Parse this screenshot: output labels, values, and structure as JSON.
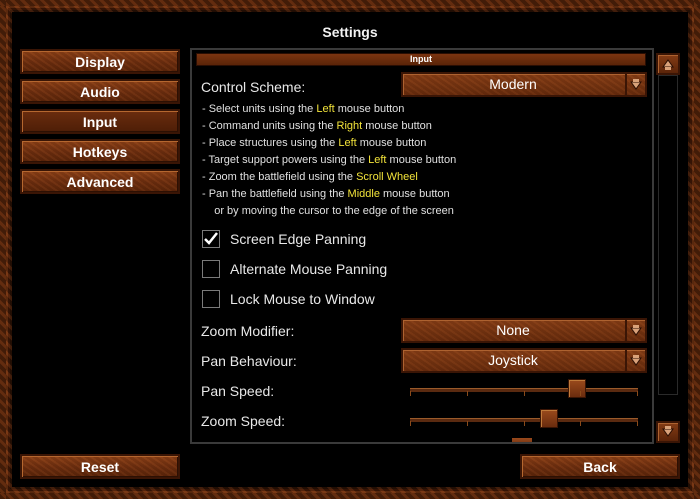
{
  "window": {
    "title": "Settings"
  },
  "nav": {
    "items": [
      {
        "label": "Display"
      },
      {
        "label": "Audio"
      },
      {
        "label": "Input",
        "active": true
      },
      {
        "label": "Hotkeys"
      },
      {
        "label": "Advanced"
      }
    ]
  },
  "panel": {
    "section_title": "Input",
    "control_scheme": {
      "label": "Control Scheme:",
      "value": "Modern"
    },
    "info_lines": [
      [
        "- Select units using the ",
        "Left",
        " mouse button"
      ],
      [
        "- Command units using the ",
        "Right",
        " mouse button"
      ],
      [
        "- Place structures using the ",
        "Left",
        " mouse button"
      ],
      [
        "- Target support powers using the ",
        "Left",
        " mouse button"
      ],
      [
        "- Zoom the battlefield using the ",
        "Scroll Wheel",
        ""
      ],
      [
        "- Pan the battlefield using the ",
        "Middle",
        " mouse button"
      ],
      [
        "  or by moving the cursor to the edge of the screen",
        "",
        ""
      ]
    ],
    "checkboxes": [
      {
        "label": "Screen Edge Panning",
        "checked": true
      },
      {
        "label": "Alternate Mouse Panning",
        "checked": false
      },
      {
        "label": "Lock Mouse to Window",
        "checked": false
      }
    ],
    "zoom_modifier": {
      "label": "Zoom Modifier:",
      "value": "None"
    },
    "pan_behaviour": {
      "label": "Pan Behaviour:",
      "value": "Joystick"
    },
    "pan_speed": {
      "label": "Pan Speed:",
      "level": 0.75
    },
    "zoom_speed": {
      "label": "Zoom Speed:",
      "level": 0.62
    }
  },
  "footer": {
    "reset_label": "Reset",
    "back_label": "Back"
  },
  "colors": {
    "highlight": "#f2e33a",
    "button": "#6a2c0e",
    "border": "#4a1f0b"
  }
}
